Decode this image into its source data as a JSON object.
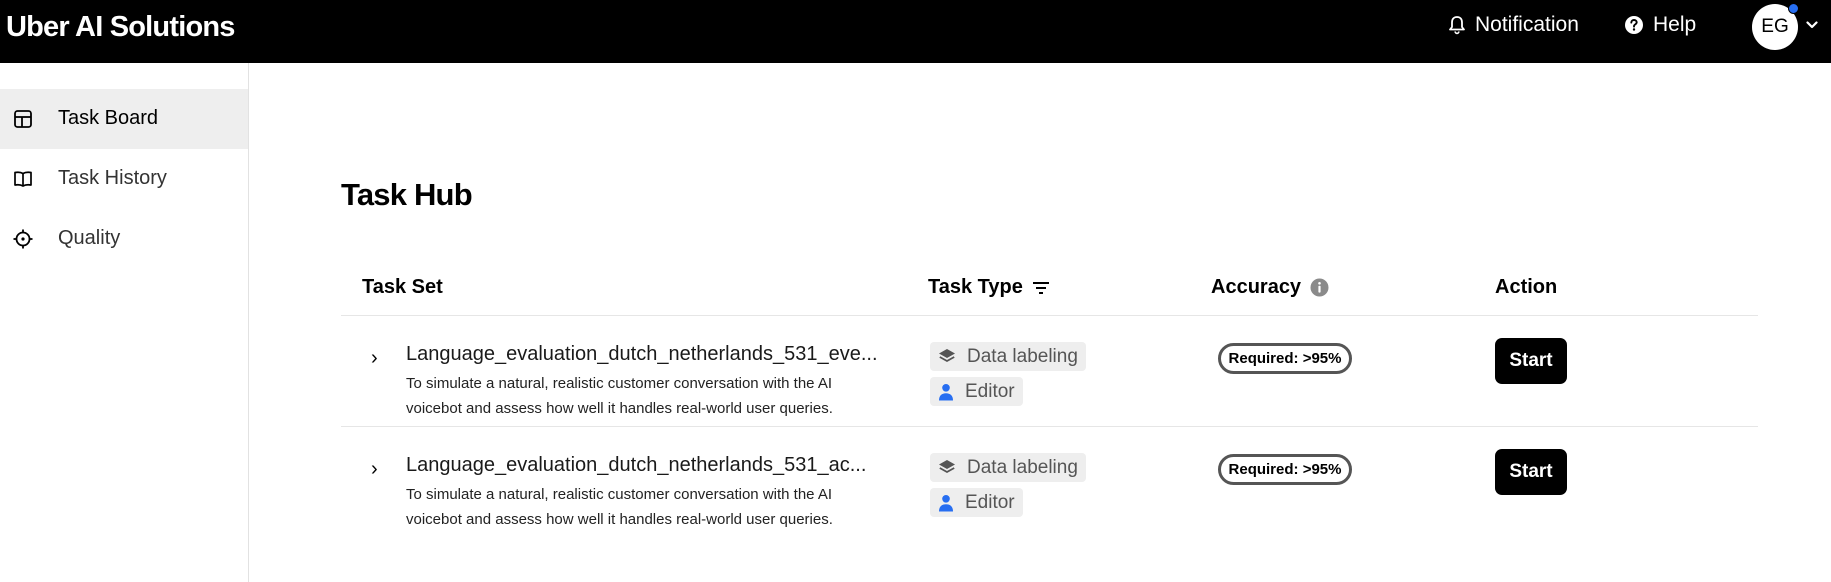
{
  "app": {
    "title": "Uber AI Solutions"
  },
  "header": {
    "notification_label": "Notification",
    "help_label": "Help",
    "avatar_initials": "EG"
  },
  "sidebar": {
    "items": [
      {
        "label": "Task Board",
        "icon": "task-board-icon",
        "active": true
      },
      {
        "label": "Task History",
        "icon": "book-icon",
        "active": false
      },
      {
        "label": "Quality",
        "icon": "crosshair-icon",
        "active": false
      }
    ]
  },
  "main": {
    "title": "Task Hub",
    "columns": {
      "task_set": "Task Set",
      "task_type": "Task Type",
      "accuracy": "Accuracy",
      "action": "Action"
    },
    "rows": [
      {
        "name": "Language_evaluation_dutch_netherlands_531_eve...",
        "description": "To simulate a natural, realistic customer conversation with the AI voicebot and assess how well it handles real-world user queries.",
        "type_tag": "Data labeling",
        "role_tag": "Editor",
        "accuracy": "Required: >95%",
        "action": "Start"
      },
      {
        "name": "Language_evaluation_dutch_netherlands_531_ac...",
        "description": "To simulate a natural, realistic customer conversation with the AI voicebot and assess how well it handles real-world user queries.",
        "type_tag": "Data labeling",
        "role_tag": "Editor",
        "accuracy": "Required: >95%",
        "action": "Start"
      }
    ]
  },
  "colors": {
    "topbar": "#000000",
    "accent_blue": "#276ef1",
    "tag_bg": "#eeeeee",
    "active_sidebar_bg": "#eeeeee"
  }
}
